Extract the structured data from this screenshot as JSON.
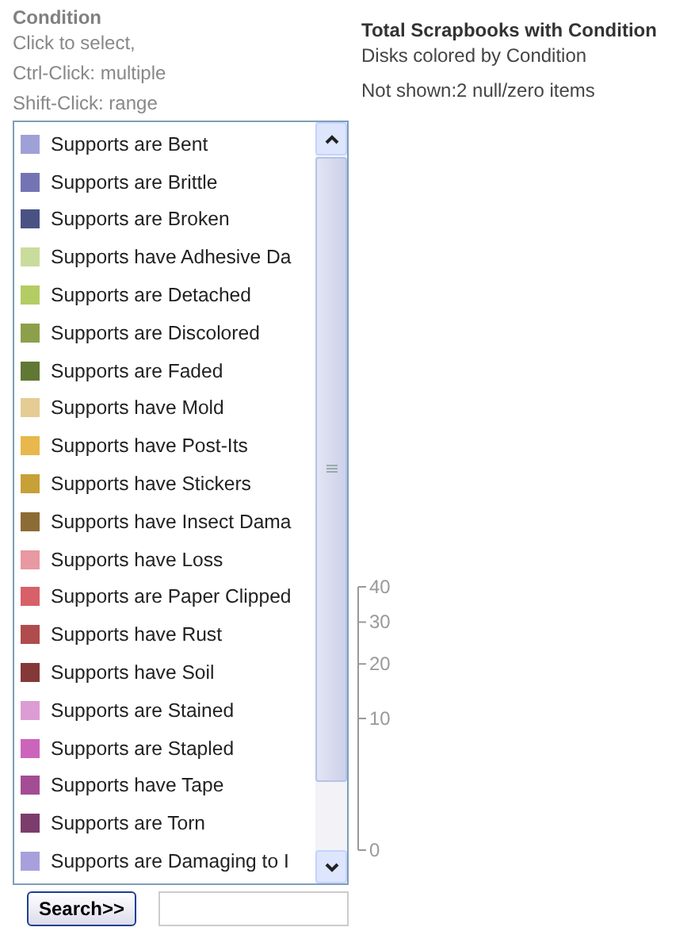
{
  "filter": {
    "heading": "Condition",
    "hints": [
      "Click to select,",
      "Ctrl-Click: multiple",
      "Shift-Click: range"
    ],
    "items": [
      {
        "label": "Supports are Bent",
        "color": "#a0a0d8",
        "selected": false
      },
      {
        "label": "Supports are Brittle",
        "color": "#7474b4",
        "selected": false
      },
      {
        "label": "Supports are Broken",
        "color": "#4a5284",
        "selected": false
      },
      {
        "label": "Supports have Adhesive Da",
        "color": "#cadc9c",
        "selected": false
      },
      {
        "label": "Supports are Detached",
        "color": "#b4cc64",
        "selected": false
      },
      {
        "label": "Supports are Discolored",
        "color": "#8ca04c",
        "selected": false
      },
      {
        "label": "Supports are Faded",
        "color": "#607834",
        "selected": false
      },
      {
        "label": "Supports have Mold",
        "color": "#e4cc94",
        "selected": false
      },
      {
        "label": "Supports have Post-Its",
        "color": "#e8b84c",
        "selected": false
      },
      {
        "label": "Supports have Stickers",
        "color": "#c8a038",
        "selected": false
      },
      {
        "label": "Supports have Insect Dama",
        "color": "#8c6c34",
        "selected": false
      },
      {
        "label": "Supports have Loss",
        "color": "#e898a0",
        "selected": false
      },
      {
        "label": "Supports are Paper Clipped",
        "color": "#d86068",
        "selected": false
      },
      {
        "label": "Supports have Rust",
        "color": "#b04c4c",
        "selected": false
      },
      {
        "label": "Supports have Soil",
        "color": "#843838",
        "selected": false
      },
      {
        "label": "Supports are Stained",
        "color": "#dc9cd4",
        "selected": false
      },
      {
        "label": "Supports are Stapled",
        "color": "#cc64bc",
        "selected": false
      },
      {
        "label": "Supports have Tape",
        "color": "#a44c94",
        "selected": false
      },
      {
        "label": "Supports are Torn",
        "color": "#7c3c6c",
        "selected": false
      },
      {
        "label": "Supports are Damaging to I",
        "color": "#a8a0dc",
        "selected": false
      }
    ],
    "search_button": "Search>>"
  },
  "chart": {
    "title": "Total Scrapbooks with Condition",
    "subtitle": "Disks colored by Condition",
    "note": "Not shown:2 null/zero items",
    "size_ticks": [
      "40",
      "30",
      "20",
      "10",
      "0"
    ]
  }
}
